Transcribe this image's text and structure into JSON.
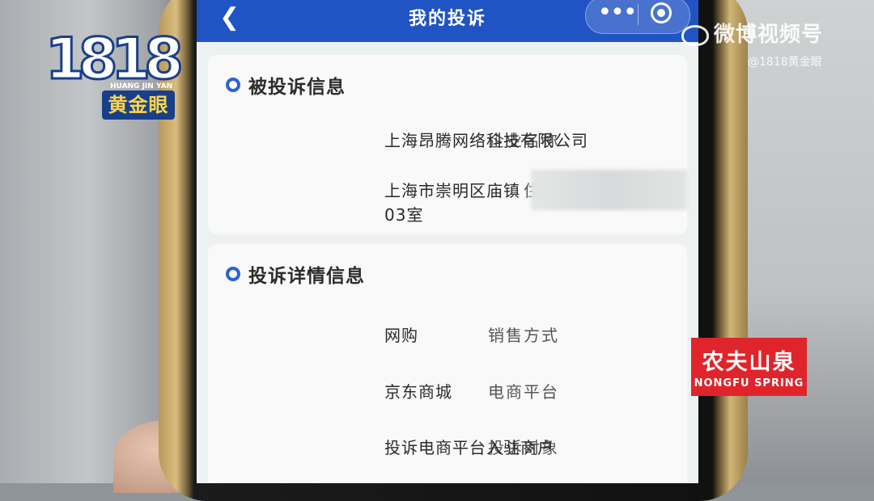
{
  "header": {
    "title": "我的投诉",
    "back_icon": "chevron-left-icon",
    "more_icon": "more-dots-icon",
    "close_icon": "target-icon"
  },
  "respondent_section": {
    "title": "被投诉信息",
    "company_label": "企业名称",
    "company_value": "上海昂腾网络科技有限公司",
    "address_label": "住所",
    "address_value_line1": "上海市崇明区庙镇",
    "address_value_line2": "03室"
  },
  "detail_section": {
    "title": "投诉详情信息",
    "sales_label": "销售方式",
    "sales_value": "网购",
    "platform_label": "电商平台",
    "platform_value": "京东商城",
    "target_label": "投诉对象",
    "target_value": "投诉电商平台入驻商户"
  },
  "overlays": {
    "logo_number": "1818",
    "logo_pinyin": "HUANG JIN YAN",
    "logo_cn": "黄金眼",
    "weibo_text": "微博视频号",
    "weibo_user": "@1818黄金眼",
    "sponsor_cn": "农夫山泉",
    "sponsor_en": "NONGFU SPRING"
  },
  "colors": {
    "header_blue": "#2054c4",
    "accent_blue": "#2a63d8",
    "sponsor_red": "#e0242b"
  }
}
